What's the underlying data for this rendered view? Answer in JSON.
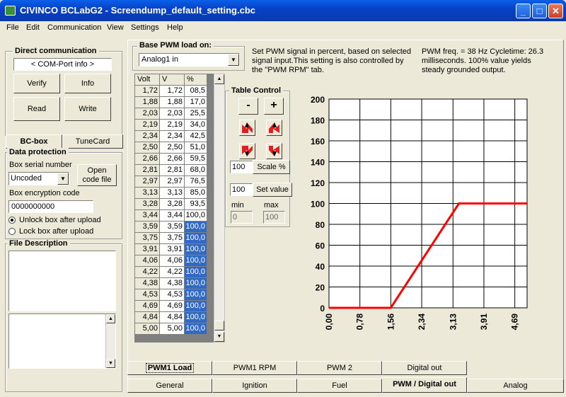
{
  "window": {
    "title": "CIVINCO  BCLabG2 - Screendump_default_setting.cbc",
    "minimize": "_",
    "maximize": "□",
    "close": "✕"
  },
  "menu": [
    "File",
    "Edit",
    "Communication",
    "View",
    "Settings",
    "Help"
  ],
  "direct_comm": {
    "title": "Direct communication",
    "com_port": "< COM-Port info >",
    "verify": "Verify",
    "info": "Info",
    "read": "Read",
    "write": "Write"
  },
  "left_tabs": [
    "BC-box",
    "TuneCard"
  ],
  "data_protection": {
    "title": "Data protection",
    "serial_label": "Box serial number",
    "serial_value": "Uncoded",
    "open_code_file_1": "Open",
    "open_code_file_2": "code file",
    "encryption_label": "Box encryption code",
    "encryption_value": "0000000000",
    "unlock_label": "Unlock box after upload",
    "lock_label": "Lock box after upload",
    "unlock_selected": true
  },
  "file_description": {
    "title": "File Description",
    "text": ""
  },
  "base_pwm": {
    "title": "Base PWM load on:",
    "selected": "Analog1 in"
  },
  "info_text_1": "Set PWM signal in percent, based on selected signal input.This setting is also controlled by the \"PWM RPM\" tab.",
  "info_text_2": "PWM freq. = 38 Hz Cycletime: 26.3 milliseconds. 100% value yields steady grounded output.",
  "table": {
    "headers": [
      "Volt",
      "V",
      "%"
    ],
    "rows": [
      [
        "1,72",
        "1,72",
        "08,5",
        false
      ],
      [
        "1,88",
        "1,88",
        "17,0",
        false
      ],
      [
        "2,03",
        "2,03",
        "25,5",
        false
      ],
      [
        "2,19",
        "2,19",
        "34,0",
        false
      ],
      [
        "2,34",
        "2,34",
        "42,5",
        false
      ],
      [
        "2,50",
        "2,50",
        "51,0",
        false
      ],
      [
        "2,66",
        "2,66",
        "59,5",
        false
      ],
      [
        "2,81",
        "2,81",
        "68,0",
        false
      ],
      [
        "2,97",
        "2,97",
        "76,5",
        false
      ],
      [
        "3,13",
        "3,13",
        "85,0",
        false
      ],
      [
        "3,28",
        "3,28",
        "93,5",
        false
      ],
      [
        "3,44",
        "3,44",
        "100,0",
        false
      ],
      [
        "3,59",
        "3,59",
        "100,0",
        true
      ],
      [
        "3,75",
        "3,75",
        "100,0",
        true
      ],
      [
        "3,91",
        "3,91",
        "100,0",
        true
      ],
      [
        "4,06",
        "4,06",
        "100,0",
        true
      ],
      [
        "4,22",
        "4,22",
        "100,0",
        true
      ],
      [
        "4,38",
        "4,38",
        "100,0",
        true
      ],
      [
        "4,53",
        "4,53",
        "100,0",
        true
      ],
      [
        "4,69",
        "4,69",
        "100,0",
        true
      ],
      [
        "4,84",
        "4,84",
        "100,0",
        true
      ],
      [
        "5,00",
        "5,00",
        "100,0",
        true
      ]
    ]
  },
  "table_control": {
    "title": "Table Control",
    "minus": "-",
    "plus": "+",
    "scale_value": "100",
    "scale_label": "Scale %",
    "set_value": "100",
    "set_label": "Set value",
    "min_label": "min",
    "max_label": "max",
    "min_value": "0",
    "max_value": "100"
  },
  "chart_data": {
    "type": "line",
    "series": [
      {
        "x": [
          0,
          1.56,
          3.28,
          5.0
        ],
        "y": [
          0,
          0,
          100,
          100
        ],
        "color": "#ff0000"
      }
    ],
    "x_ticks": [
      "0,00",
      "0,78",
      "1,56",
      "2,34",
      "3,13",
      "3,91",
      "4,69"
    ],
    "x_tick_values": [
      0,
      0.78,
      1.56,
      2.34,
      3.13,
      3.91,
      4.69
    ],
    "y_ticks": [
      "0",
      "20",
      "40",
      "60",
      "80",
      "100",
      "120",
      "140",
      "160",
      "180",
      "200"
    ],
    "xlim": [
      0,
      5.0
    ],
    "ylim": [
      0,
      200
    ],
    "grid": true
  },
  "pwm_tabs": [
    "PWM1 Load",
    "PWM1 RPM",
    "PWM 2",
    "Digital out"
  ],
  "main_tabs": [
    "General",
    "Ignition",
    "Fuel",
    "PWM / Digital out",
    "Analog"
  ]
}
